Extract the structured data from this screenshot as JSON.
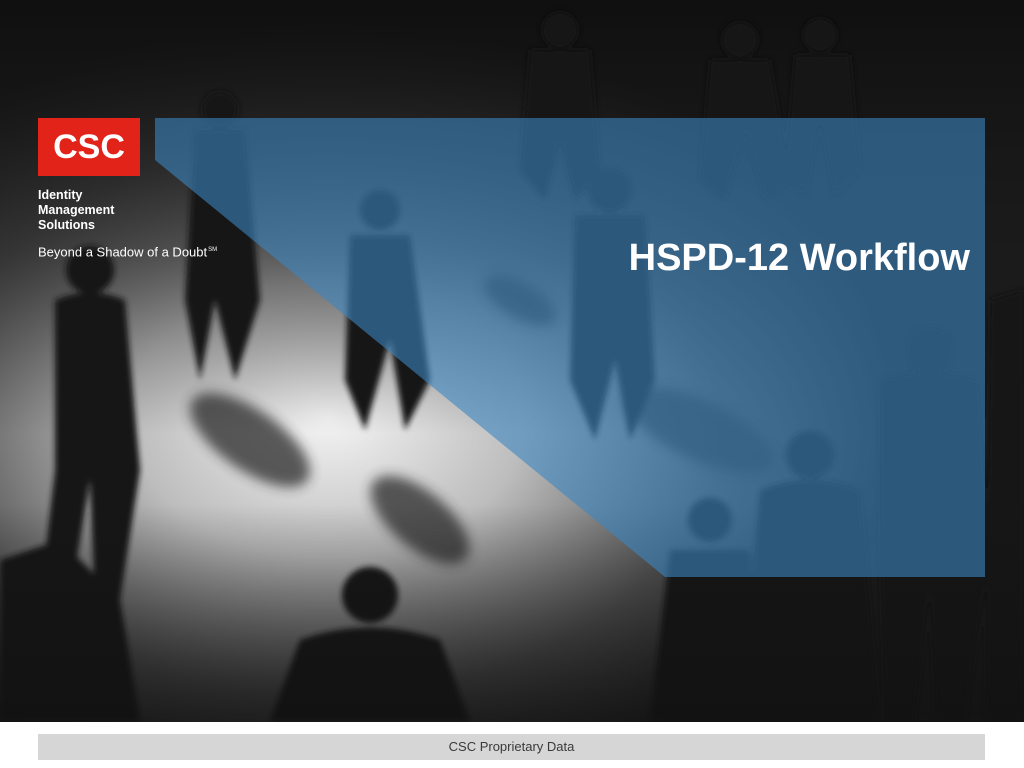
{
  "slide": {
    "title": "HSPD-12 Workflow"
  },
  "branding": {
    "logo_text": "CSC",
    "division_lines": [
      "Identity",
      "Management",
      "Solutions"
    ],
    "tagline": "Beyond a Shadow of  a Doubt",
    "tagline_mark": "SM",
    "brand_color": "#e2231a"
  },
  "footer": {
    "text": "CSC Proprietary Data"
  },
  "colors": {
    "overlay_blue": "#3c7fb5",
    "footer_bar": "#d6d6d6",
    "background": "#ffffff"
  },
  "background_image": {
    "icon": "crowd-silhouette-photo"
  }
}
